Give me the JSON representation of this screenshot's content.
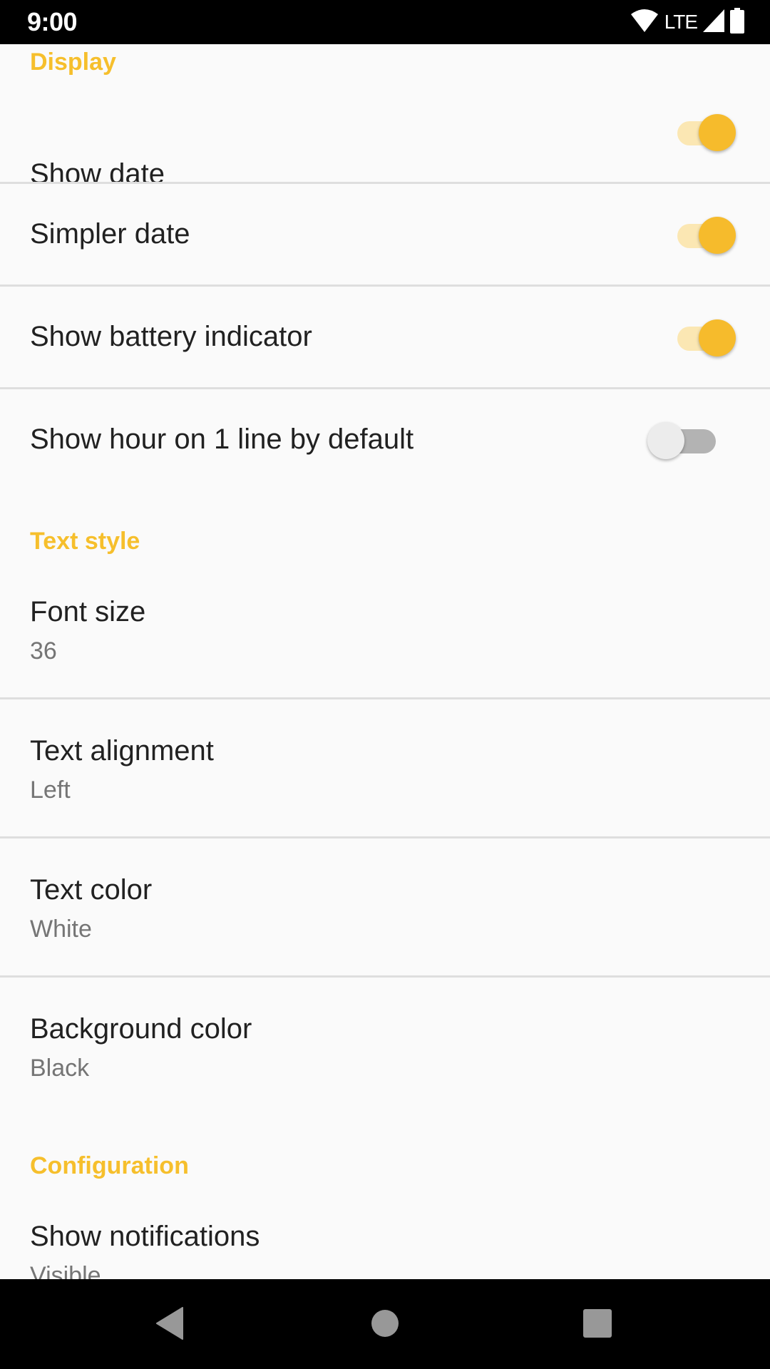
{
  "status_bar": {
    "time": "9:00",
    "network": "LTE",
    "icons": [
      "wifi-icon",
      "lte-icon",
      "signal-icon",
      "battery-icon"
    ]
  },
  "colors": {
    "accent": "#f6bb2c",
    "header": "#f6bf2c",
    "title_text": "#212121",
    "summary_text": "#757575",
    "divider": "#dedede",
    "background": "#fafafa"
  },
  "sections": {
    "display": {
      "header": "Display",
      "items": [
        {
          "title": "Show date",
          "checked": true
        },
        {
          "title": "Simpler date",
          "checked": true
        },
        {
          "title": "Show battery indicator",
          "checked": true
        },
        {
          "title": "Show hour on 1 line by default",
          "checked": false
        }
      ]
    },
    "text_style": {
      "header": "Text style",
      "items": [
        {
          "title": "Font size",
          "summary": "36"
        },
        {
          "title": "Text alignment",
          "summary": "Left"
        },
        {
          "title": "Text color",
          "summary": "White"
        },
        {
          "title": "Background color",
          "summary": "Black"
        }
      ]
    },
    "configuration": {
      "header": "Configuration",
      "items": [
        {
          "title": "Show notifications",
          "summary": "Visible"
        }
      ]
    }
  },
  "nav_bar": {
    "buttons": [
      "back",
      "home",
      "recents"
    ]
  }
}
